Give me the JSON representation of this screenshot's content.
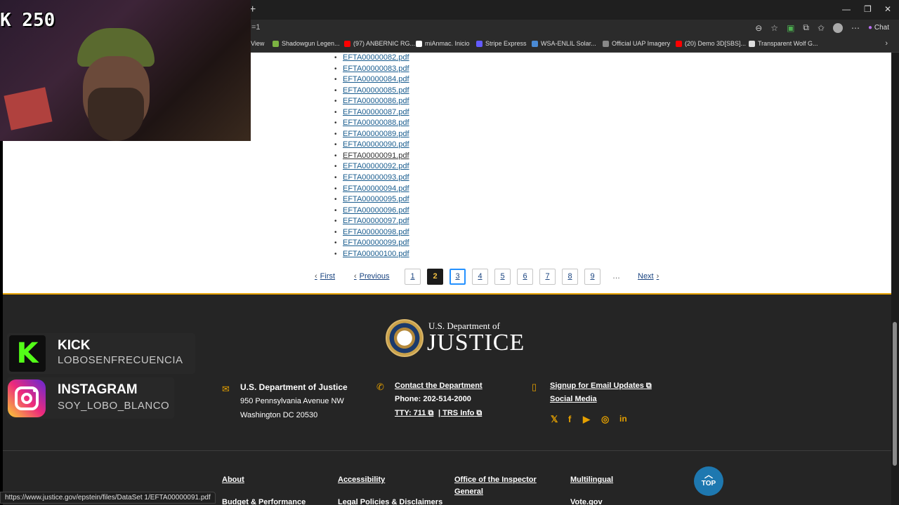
{
  "browser": {
    "url_fragment": "=1",
    "chat_label": "Chat",
    "bookmarks": [
      {
        "label": "View",
        "color": "#2b2b2b"
      },
      {
        "label": "Shadowgun Legen...",
        "color": "#7cb342"
      },
      {
        "label": "(97) ANBERNIC RG...",
        "color": "#ff0000"
      },
      {
        "label": "miAnmac. Inicio",
        "color": "#ffffff"
      },
      {
        "label": "Stripe Express",
        "color": "#635bff"
      },
      {
        "label": "WSA-ENLIL Solar...",
        "color": "#4a8ad4"
      },
      {
        "label": "Official UAP Imagery",
        "color": "#888888"
      },
      {
        "label": "(20) Demo 3D[SBS]...",
        "color": "#ff0000"
      },
      {
        "label": "Transparent Wolf G...",
        "color": "#dddddd"
      }
    ]
  },
  "files": [
    {
      "name": "EFTA00000082.pdf",
      "visited": false
    },
    {
      "name": "EFTA00000083.pdf",
      "visited": false
    },
    {
      "name": "EFTA00000084.pdf",
      "visited": false
    },
    {
      "name": "EFTA00000085.pdf",
      "visited": false
    },
    {
      "name": "EFTA00000086.pdf",
      "visited": false
    },
    {
      "name": "EFTA00000087.pdf",
      "visited": false
    },
    {
      "name": "EFTA00000088.pdf",
      "visited": false
    },
    {
      "name": "EFTA00000089.pdf",
      "visited": false
    },
    {
      "name": "EFTA00000090.pdf",
      "visited": false
    },
    {
      "name": "EFTA00000091.pdf",
      "visited": true
    },
    {
      "name": "EFTA00000092.pdf",
      "visited": false
    },
    {
      "name": "EFTA00000093.pdf",
      "visited": false
    },
    {
      "name": "EFTA00000094.pdf",
      "visited": false
    },
    {
      "name": "EFTA00000095.pdf",
      "visited": false
    },
    {
      "name": "EFTA00000096.pdf",
      "visited": false
    },
    {
      "name": "EFTA00000097.pdf",
      "visited": false
    },
    {
      "name": "EFTA00000098.pdf",
      "visited": false
    },
    {
      "name": "EFTA00000099.pdf",
      "visited": false
    },
    {
      "name": "EFTA00000100.pdf",
      "visited": false
    }
  ],
  "pagination": {
    "first": "First",
    "previous": "Previous",
    "pages": [
      "1",
      "2",
      "3",
      "4",
      "5",
      "6",
      "7",
      "8",
      "9"
    ],
    "current_page": "2",
    "focused_page": "3",
    "ellipsis": "…",
    "next": "Next"
  },
  "footer": {
    "agency_small": "U.S. Department of",
    "agency_big": "JUSTICE",
    "address_title": "U.S. Department of Justice",
    "address_line1": "950 Pennsylvania Avenue NW",
    "address_line2": "Washington DC 20530",
    "contact_link": "Contact the Department",
    "phone": "Phone: 202-514-2000",
    "tty": "TTY: 711",
    "trs": "| TRS Info",
    "signup": "Signup for Email Updates",
    "social_media": "Social Media",
    "nav": [
      "About",
      "Accessibility",
      "Office of the Inspector",
      "General",
      "Multilingual",
      "Budget & Performance",
      "Legal Policies & Disclaimers",
      "Vote.gov"
    ],
    "top_label": "TOP",
    "accent": "#e5a000"
  },
  "overlay": {
    "counter": "K 250",
    "kick_title": "KICK",
    "kick_user": "LOBOSENFRECUENCIA",
    "ig_title": "INSTAGRAM",
    "ig_user": "SOY_LOBO_BLANCO",
    "kick_color": "#53fc18"
  },
  "status_url": "https://www.justice.gov/epstein/files/DataSet 1/EFTA00000091.pdf"
}
